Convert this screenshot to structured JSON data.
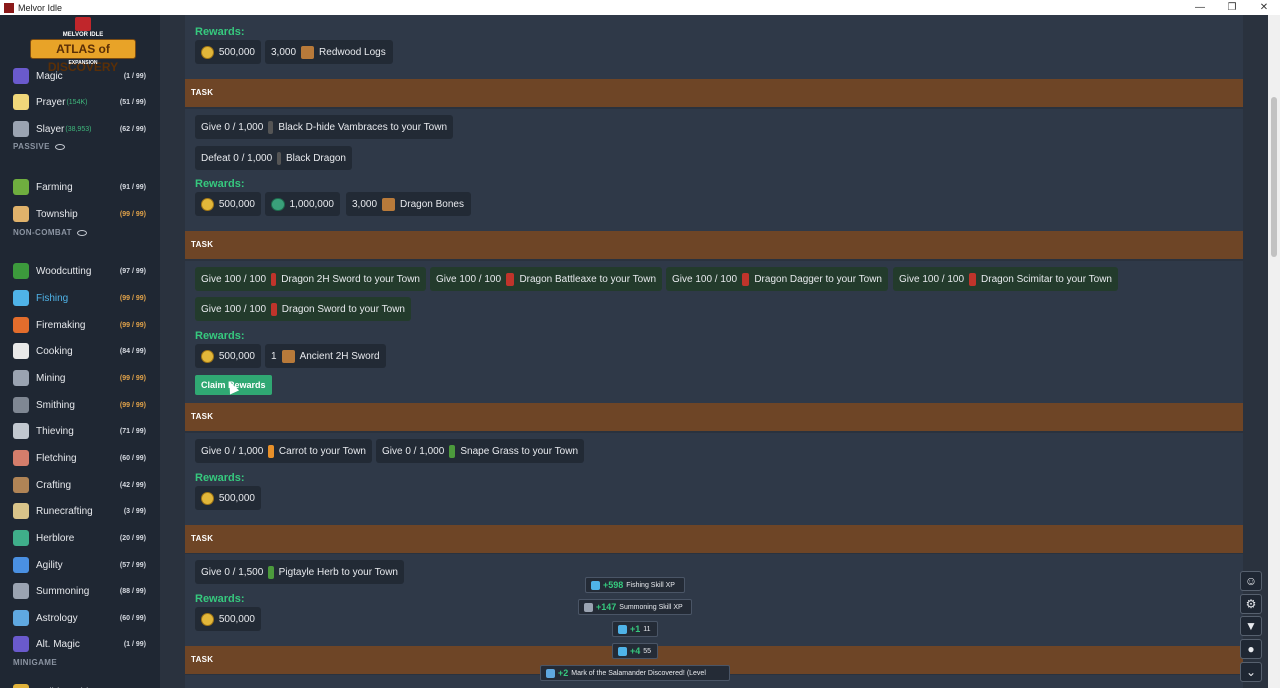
{
  "window": {
    "title": "Melvor Idle",
    "controls": [
      "—",
      "❐",
      "✕"
    ]
  },
  "logo": {
    "small": "MELVOR IDLE",
    "main": "ATLAS of DISCOVERY",
    "expansion": "EXPANSION"
  },
  "sidebar": {
    "skills_top": [
      {
        "name": "Magic",
        "extra": "",
        "level": "(1 / 99)",
        "max": false,
        "icon": "magic-hat-icon",
        "color": "#6a5acd"
      },
      {
        "name": "Prayer",
        "extra": "(154K)",
        "level": "(51 / 99)",
        "max": false,
        "icon": "prayer-star-icon",
        "color": "#f0d77a"
      },
      {
        "name": "Slayer",
        "extra": "(38,953)",
        "level": "(62 / 99)",
        "max": false,
        "icon": "slayer-icon",
        "color": "#9aa3b1"
      }
    ],
    "passive_label": "PASSIVE",
    "skills_passive": [
      {
        "name": "Farming",
        "extra": "",
        "level": "(91 / 99)",
        "max": false,
        "icon": "farming-icon",
        "color": "#6fae3f"
      },
      {
        "name": "Township",
        "extra": "",
        "level": "(99 / 99)",
        "max": true,
        "icon": "township-icon",
        "color": "#e0b26b"
      }
    ],
    "noncombat_label": "NON-COMBAT",
    "skills_noncombat": [
      {
        "name": "Woodcutting",
        "extra": "",
        "level": "(97 / 99)",
        "max": false,
        "icon": "tree-icon",
        "color": "#3c9a3c"
      },
      {
        "name": "Fishing",
        "extra": "",
        "level": "(99 / 99)",
        "max": true,
        "icon": "fish-icon",
        "color": "#4fb3e8"
      },
      {
        "name": "Firemaking",
        "extra": "",
        "level": "(99 / 99)",
        "max": true,
        "icon": "fire-icon",
        "color": "#e36d2c"
      },
      {
        "name": "Cooking",
        "extra": "",
        "level": "(84 / 99)",
        "max": false,
        "icon": "chef-hat-icon",
        "color": "#e9e9e9"
      },
      {
        "name": "Mining",
        "extra": "",
        "level": "(99 / 99)",
        "max": true,
        "icon": "pickaxe-icon",
        "color": "#9aa3b1"
      },
      {
        "name": "Smithing",
        "extra": "",
        "level": "(99 / 99)",
        "max": true,
        "icon": "anvil-icon",
        "color": "#7f8793"
      },
      {
        "name": "Thieving",
        "extra": "",
        "level": "(71 / 99)",
        "max": false,
        "icon": "thief-icon",
        "color": "#c2c8d0"
      },
      {
        "name": "Fletching",
        "extra": "",
        "level": "(60 / 99)",
        "max": false,
        "icon": "arrow-icon",
        "color": "#d47d6b"
      },
      {
        "name": "Crafting",
        "extra": "",
        "level": "(42 / 99)",
        "max": false,
        "icon": "crafting-icon",
        "color": "#b08456"
      },
      {
        "name": "Runecrafting",
        "extra": "",
        "level": "(3 / 99)",
        "max": false,
        "icon": "rune-icon",
        "color": "#d9c48a"
      },
      {
        "name": "Herblore",
        "extra": "",
        "level": "(20 / 99)",
        "max": false,
        "icon": "herb-icon",
        "color": "#3fae8a"
      },
      {
        "name": "Agility",
        "extra": "",
        "level": "(57 / 99)",
        "max": false,
        "icon": "agility-icon",
        "color": "#4a90e2"
      },
      {
        "name": "Summoning",
        "extra": "",
        "level": "(88 / 99)",
        "max": false,
        "icon": "wolf-icon",
        "color": "#9aa3b1"
      },
      {
        "name": "Astrology",
        "extra": "",
        "level": "(60 / 99)",
        "max": false,
        "icon": "astrology-icon",
        "color": "#5fa8e0"
      },
      {
        "name": "Alt. Magic",
        "extra": "",
        "level": "(1 / 99)",
        "max": false,
        "icon": "alt-magic-icon",
        "color": "#6a5acd"
      }
    ],
    "minigame_label": "MINIGAME",
    "skills_minigame": [
      {
        "name": "Golbin Raid",
        "extra": "",
        "level": "Public Test",
        "max": false,
        "icon": "golbin-icon",
        "color": "#e0b23a"
      }
    ]
  },
  "tasks": {
    "task_label": "TASK",
    "rewards_label": "Rewards:",
    "t0": {
      "rewards": [
        {
          "qty": "500,000",
          "name": "",
          "icon": "gp-coin-icon"
        },
        {
          "qty": "3,000",
          "name": "Redwood Logs",
          "icon": "redwood-logs-icon"
        }
      ]
    },
    "t1": {
      "goals": [
        {
          "text": "Give 0 / 1,000",
          "item": "Black D-hide Vambraces to your Town",
          "icon": "vambraces-icon"
        },
        {
          "text": "Defeat 0 / 1,000",
          "item": "Black Dragon",
          "icon": "black-dragon-icon"
        }
      ],
      "rewards": [
        {
          "qty": "500,000",
          "name": "",
          "icon": "gp-coin-icon"
        },
        {
          "qty": "1,000,000",
          "name": "",
          "icon": "slayer-coin-icon"
        },
        {
          "qty": "3,000",
          "name": "Dragon Bones",
          "icon": "dragon-bones-icon"
        }
      ]
    },
    "t2": {
      "goals": [
        {
          "text": "Give 100 / 100",
          "item": "Dragon 2H Sword to your Town",
          "icon": "dragon-2h-sword-icon"
        },
        {
          "text": "Give 100 / 100",
          "item": "Dragon Battleaxe to your Town",
          "icon": "dragon-battleaxe-icon"
        },
        {
          "text": "Give 100 / 100",
          "item": "Dragon Dagger to your Town",
          "icon": "dragon-dagger-icon"
        },
        {
          "text": "Give 100 / 100",
          "item": "Dragon Scimitar to your Town",
          "icon": "dragon-scimitar-icon"
        },
        {
          "text": "Give 100 / 100",
          "item": "Dragon Sword to your Town",
          "icon": "dragon-sword-icon"
        }
      ],
      "rewards": [
        {
          "qty": "500,000",
          "name": "",
          "icon": "gp-coin-icon"
        },
        {
          "qty": "1",
          "name": "Ancient 2H Sword",
          "icon": "ancient-2h-sword-icon"
        }
      ],
      "claim_label": "Claim Rewards"
    },
    "t3": {
      "goals": [
        {
          "text": "Give 0 / 1,000",
          "item": "Carrot to your Town",
          "icon": "carrot-icon"
        },
        {
          "text": "Give 0 / 1,000",
          "item": "Snape Grass to your Town",
          "icon": "snape-grass-icon"
        }
      ],
      "rewards": [
        {
          "qty": "500,000",
          "name": "",
          "icon": "gp-coin-icon"
        }
      ]
    },
    "t4": {
      "goals": [
        {
          "text": "Give 0 / 1,500",
          "item": "Pigtayle Herb to your Town",
          "icon": "pigtayle-herb-icon"
        }
      ],
      "rewards": [
        {
          "qty": "500,000",
          "name": "",
          "icon": "gp-coin-icon"
        }
      ]
    }
  },
  "toasts": [
    {
      "plus": "+598",
      "text": "Fishing Skill XP",
      "icon": "fish-icon"
    },
    {
      "plus": "+147",
      "text": "Summoning Skill XP",
      "icon": "wolf-icon"
    },
    {
      "plus": "+1",
      "text": "11",
      "icon": "fish-icon"
    },
    {
      "plus": "+4",
      "text": "55",
      "icon": "fish-icon"
    },
    {
      "plus": "+2",
      "text": "Mark of the Salamander Discovered! (Level",
      "icon": "mark-icon"
    }
  ],
  "side_buttons": [
    {
      "name": "character-icon",
      "glyph": "☺"
    },
    {
      "name": "settings-gear-icon",
      "glyph": "⚙"
    },
    {
      "name": "wolf-icon",
      "glyph": "▼"
    },
    {
      "name": "medal-icon",
      "glyph": "●"
    },
    {
      "name": "chevron-down-icon",
      "glyph": "⌄"
    }
  ],
  "colors": {
    "accent": "#36c97e",
    "task_header": "#6e4526",
    "gold": "#e2b73a"
  }
}
